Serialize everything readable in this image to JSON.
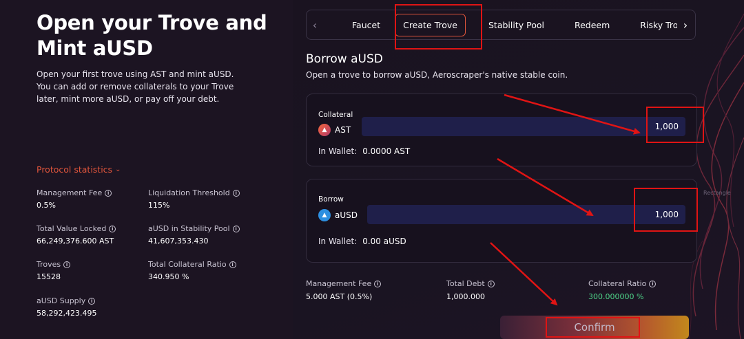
{
  "hero": {
    "title": "Open your Trove and Mint aUSD",
    "description": "Open your first trove using AST and mint aUSD. You can add or remove collaterals to your Trove later, mint more aUSD, or pay off your debt."
  },
  "stats": {
    "toggle_label": "Protocol statistics",
    "items": [
      {
        "label": "Management Fee",
        "value": "0.5%"
      },
      {
        "label": "Liquidation Threshold",
        "value": "115%"
      },
      {
        "label": "Total Value Locked",
        "value": "66,249,376.600 AST"
      },
      {
        "label": "aUSD in Stability Pool",
        "value": "41,607,353.430"
      },
      {
        "label": "Troves",
        "value": "15528"
      },
      {
        "label": "Total Collateral Ratio",
        "value": "340.950 %"
      },
      {
        "label": "aUSD Supply",
        "value": "58,292,423.495"
      }
    ]
  },
  "tabs": {
    "prev_icon": "chevron-left-icon",
    "next_icon": "chevron-right-icon",
    "items": [
      {
        "label": "Faucet",
        "active": false
      },
      {
        "label": "Create Trove",
        "active": true
      },
      {
        "label": "Stability Pool",
        "active": false
      },
      {
        "label": "Redeem",
        "active": false
      },
      {
        "label": "Risky Trove",
        "active": false
      }
    ]
  },
  "section": {
    "title": "Borrow aUSD",
    "subtitle": "Open a trove to borrow aUSD, Aeroscraper's native stable coin."
  },
  "collateral": {
    "label": "Collateral",
    "asset": "AST",
    "amount": "1,000",
    "wallet_label": "In Wallet:",
    "wallet_value": "0.0000 AST"
  },
  "borrow": {
    "label": "Borrow",
    "asset": "aUSD",
    "amount": "1,000",
    "wallet_label": "In Wallet:",
    "wallet_value": "0.00 aUSD"
  },
  "summary": {
    "management_fee_label": "Management Fee",
    "management_fee_value": "5.000 AST (0.5%)",
    "total_debt_label": "Total Debt",
    "total_debt_value": "1,000.000",
    "collateral_ratio_label": "Collateral Ratio",
    "collateral_ratio_value": "300.000000 %"
  },
  "confirm_label": "Confirm",
  "rectangle_note": "Rectangle",
  "colors": {
    "accent": "#e0553c",
    "annotation_red": "#e01414",
    "ratio_green": "#4fd68a",
    "input_bg": "#1f1f4a"
  }
}
